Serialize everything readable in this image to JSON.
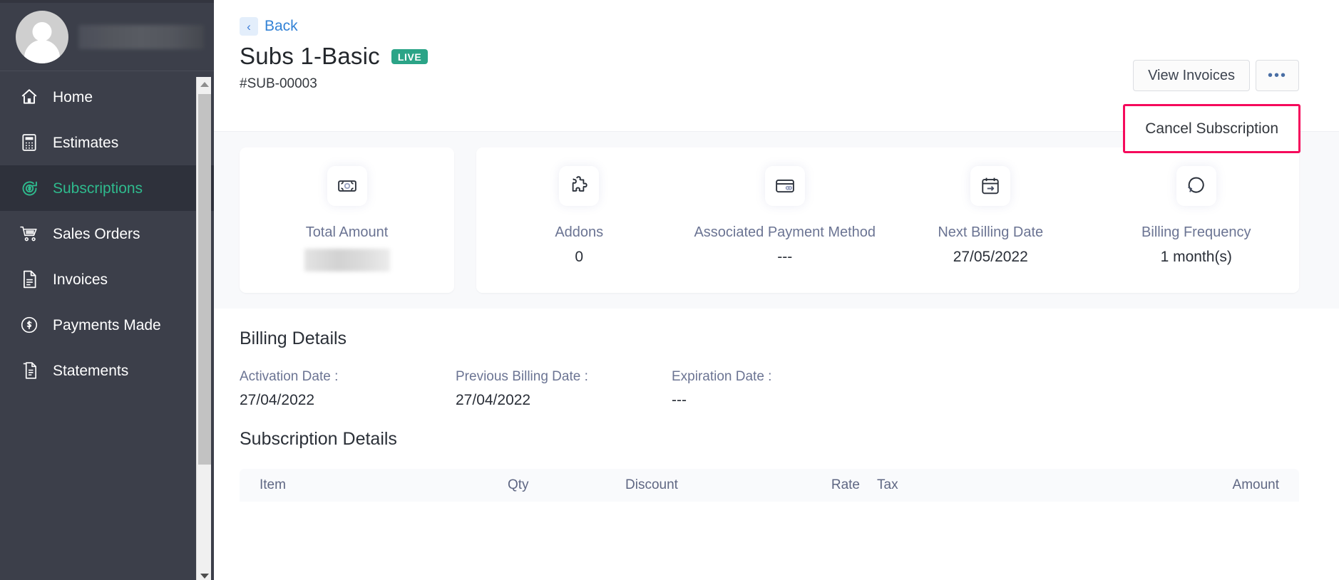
{
  "sidebar": {
    "profile": {
      "name": "",
      "avatar_icon": "user-avatar-icon",
      "name_redacted": true
    },
    "items": [
      {
        "label": "Home",
        "icon": "home-icon",
        "active": false
      },
      {
        "label": "Estimates",
        "icon": "calculator-icon",
        "active": false
      },
      {
        "label": "Subscriptions",
        "icon": "subscription-refresh-dollar-icon",
        "active": true
      },
      {
        "label": "Sales Orders",
        "icon": "shopping-cart-icon",
        "active": false
      },
      {
        "label": "Invoices",
        "icon": "document-lines-icon",
        "active": false
      },
      {
        "label": "Payments Made",
        "icon": "dollar-circle-icon",
        "active": false
      },
      {
        "label": "Statements",
        "icon": "statement-document-icon",
        "active": false
      }
    ],
    "scrollbar": {
      "up_arrow": "scroll-up-arrow-icon",
      "down_arrow": "scroll-down-arrow-icon"
    }
  },
  "header": {
    "back_label": "Back",
    "back_icon": "chevron-left-icon",
    "title": "Subs 1-Basic",
    "status_badge": "LIVE",
    "subscription_number": "#SUB-00003",
    "buttons": {
      "view_invoices": "View Invoices",
      "more_label": "•••",
      "more_icon": "ellipsis-horizontal-icon"
    },
    "dropdown": {
      "highlight_color": "#f50a5c",
      "items": [
        {
          "label": "Cancel Subscription"
        }
      ]
    }
  },
  "summary_cards": [
    {
      "label": "Total Amount",
      "value": "",
      "value_redacted": true,
      "icon": "banknote-icon"
    },
    {
      "label": "Addons",
      "value": "0",
      "value_redacted": false,
      "icon": "puzzle-piece-icon"
    },
    {
      "label": "Associated Payment Method",
      "value": "---",
      "value_redacted": false,
      "icon": "credit-card-icon"
    },
    {
      "label": "Next Billing Date",
      "value": "27/05/2022",
      "value_redacted": false,
      "icon": "calendar-arrow-icon"
    },
    {
      "label": "Billing Frequency",
      "value": "1 month(s)",
      "value_redacted": false,
      "icon": "refresh-circle-icon"
    }
  ],
  "billing_details": {
    "title": "Billing Details",
    "fields": [
      {
        "label": "Activation Date :",
        "value": "27/04/2022"
      },
      {
        "label": "Previous Billing Date :",
        "value": "27/04/2022"
      },
      {
        "label": "Expiration Date :",
        "value": "---"
      }
    ]
  },
  "subscription_details": {
    "title": "Subscription Details",
    "columns": [
      "Item",
      "Qty",
      "Discount",
      "Rate",
      "Tax",
      "Amount"
    ]
  },
  "colors": {
    "sidebar_bg": "#3c3f4a",
    "sidebar_active_bg": "#2e313b",
    "accent_green": "#2fba8d",
    "badge_green": "#2ba487",
    "link_blue": "#3483d6",
    "highlight_pink": "#f50a5c",
    "band_bg": "#f8f9fb",
    "muted_text": "#6b7493"
  }
}
